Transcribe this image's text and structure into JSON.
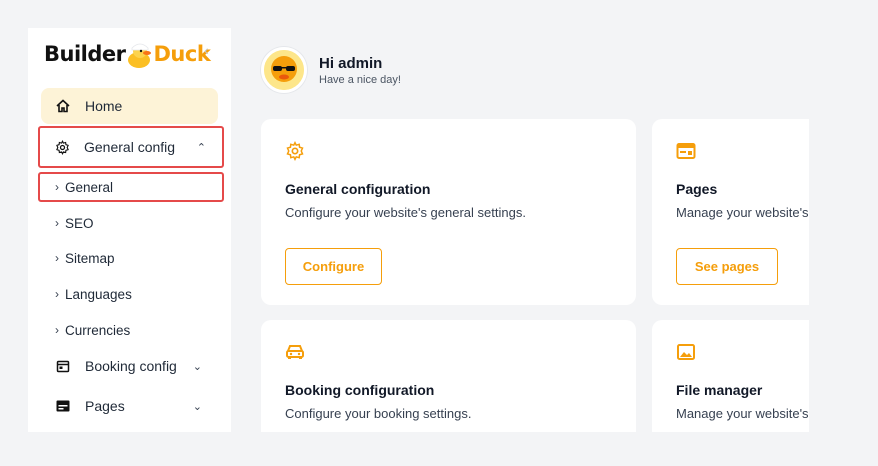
{
  "sidebar": {
    "logo": {
      "part1": "Builder",
      "part2": "Duck"
    },
    "collapse_icon": "chevron-left-icon",
    "items": [
      {
        "label": "Home",
        "icon": "home-icon"
      },
      {
        "label": "General config",
        "icon": "gear-icon",
        "expanded": true
      },
      {
        "label": "General",
        "active": true
      },
      {
        "label": "SEO"
      },
      {
        "label": "Sitemap"
      },
      {
        "label": "Languages"
      },
      {
        "label": "Currencies"
      },
      {
        "label": "Booking config",
        "icon": "calendar-icon"
      },
      {
        "label": "Pages",
        "icon": "pages-icon"
      }
    ]
  },
  "header": {
    "greeting": "Hi admin",
    "subtitle": "Have a nice day!"
  },
  "cards": [
    {
      "title": "General configuration",
      "desc": "Configure your website's general settings.",
      "button": "Configure",
      "icon": "gear-icon"
    },
    {
      "title": "Pages",
      "desc": "Manage your website's",
      "button": "See pages",
      "icon": "browser-icon"
    },
    {
      "title": "Booking configuration",
      "desc": "Configure your booking settings.",
      "icon": "car-icon"
    },
    {
      "title": "File manager",
      "desc": "Manage your website's",
      "icon": "image-icon"
    }
  ],
  "colors": {
    "accent": "#f59e0b",
    "highlight": "#e54a4a",
    "home_bg": "#fdf3d7"
  }
}
